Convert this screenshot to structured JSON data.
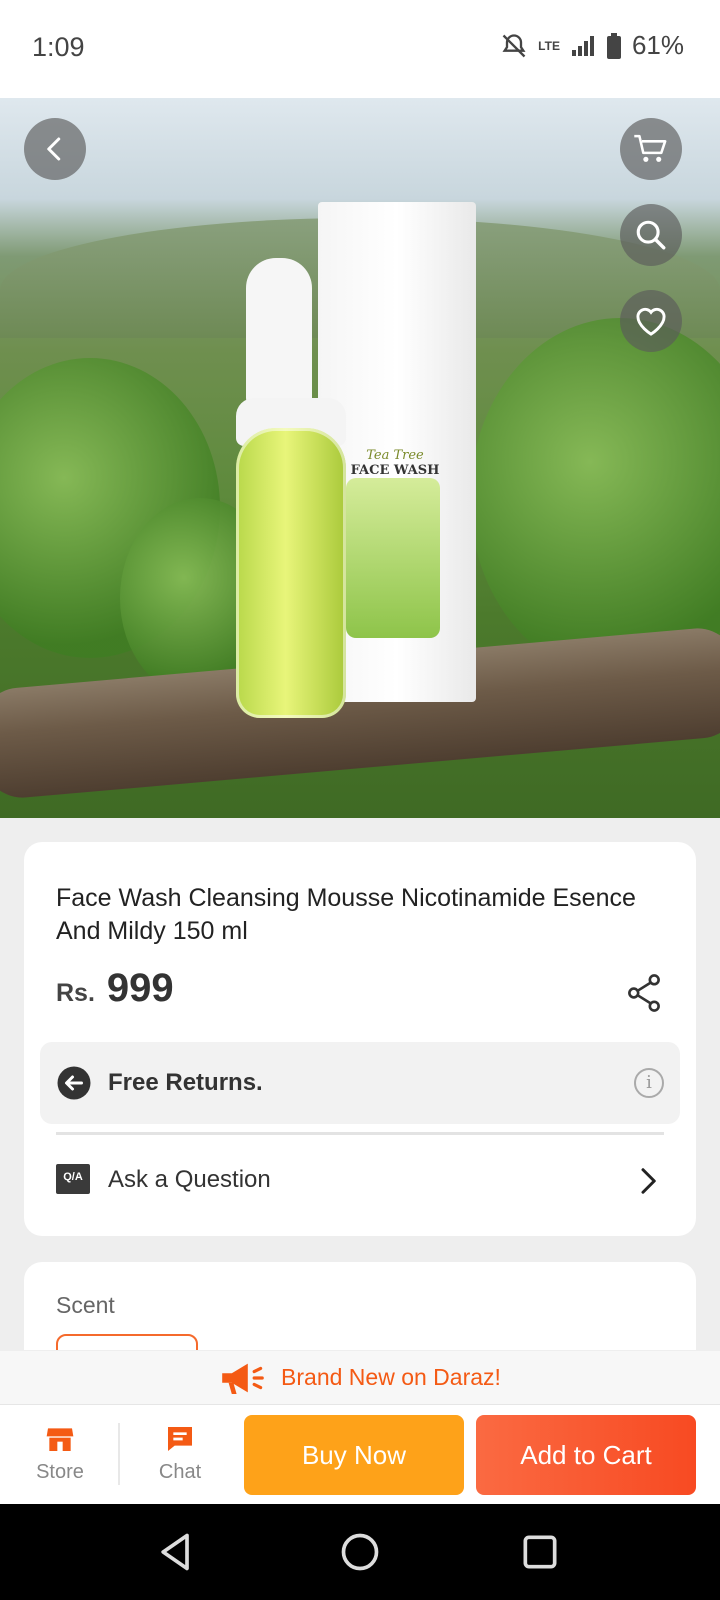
{
  "status_bar": {
    "time": "1:09",
    "network": "LTE",
    "battery": "61%"
  },
  "hero": {
    "box_label_line1": "Tea Tree",
    "box_label_line2": "FACE WASH",
    "icons": [
      "back-arrow-icon",
      "cart-icon",
      "search-icon",
      "heart-icon"
    ]
  },
  "product": {
    "title": "Face Wash Cleansing Mousse Nicotinamide Esence And Mildy 150 ml",
    "currency": "Rs.",
    "price": "999",
    "returns": "Free Returns.",
    "ask_label": "Ask a Question",
    "qa_badge": "Q/A"
  },
  "scent": {
    "label": "Scent"
  },
  "banner": {
    "text": "Brand New on Daraz!"
  },
  "bottom_bar": {
    "store_label": "Store",
    "chat_label": "Chat",
    "buy_now_label": "Buy Now",
    "add_to_cart_label": "Add to Cart"
  },
  "colors": {
    "accent": "#f45a14",
    "buy_now": "#fea219",
    "add_to_cart": "#f84a22"
  }
}
